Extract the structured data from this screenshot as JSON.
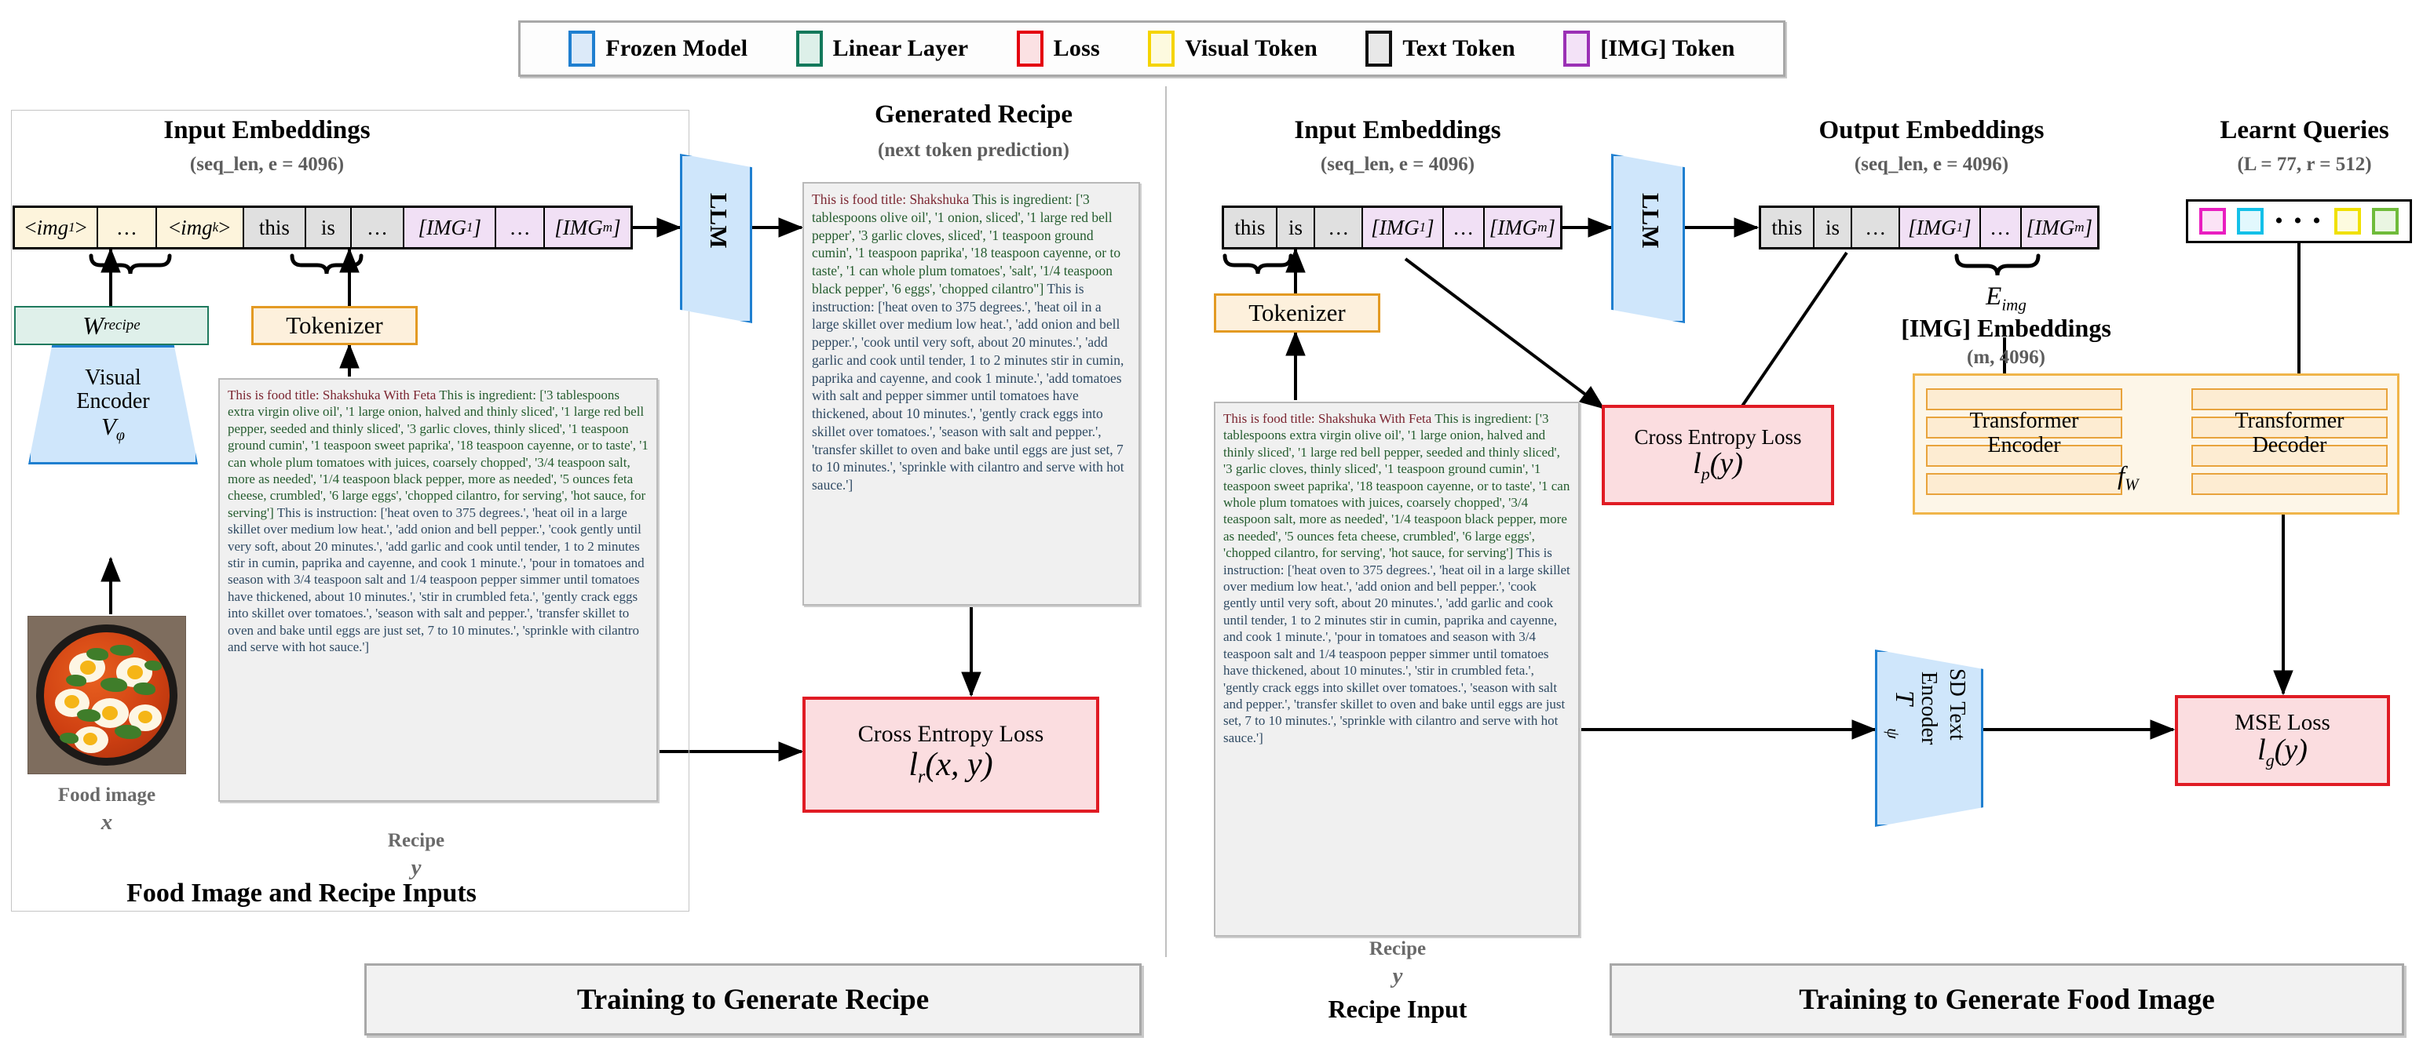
{
  "legend": {
    "items": [
      {
        "label": "Frozen Model",
        "border": "#1f7fd0",
        "fill": "#dceaf9",
        "icon": "frozen-model-swatch"
      },
      {
        "label": "Linear Layer",
        "border": "#13795b",
        "fill": "#ddf0e9",
        "icon": "linear-layer-swatch"
      },
      {
        "label": "Loss",
        "border": "#e4000f",
        "fill": "#fbe1e3",
        "icon": "loss-swatch"
      },
      {
        "label": "Visual Token",
        "border": "#f5d400",
        "fill": "#fdfadf",
        "icon": "visual-token-swatch"
      },
      {
        "label": "Text Token",
        "border": "#111111",
        "fill": "#e8e8e8",
        "icon": "text-token-swatch"
      },
      {
        "label": "[IMG] Token",
        "border": "#9b30b5",
        "fill": "#f3e2f7",
        "icon": "img-token-swatch"
      }
    ]
  },
  "left": {
    "input_embeddings": {
      "title": "Input Embeddings",
      "subtitle": "(seq_len, e = 4096)",
      "tokens": [
        {
          "text": "<img₁>",
          "kind": "visual"
        },
        {
          "text": "…",
          "kind": "visual"
        },
        {
          "text": "<imgₖ>",
          "kind": "visual"
        },
        {
          "text": "this",
          "kind": "text"
        },
        {
          "text": "is",
          "kind": "text"
        },
        {
          "text": "…",
          "kind": "text"
        },
        {
          "text": "[IMG₁]",
          "kind": "img"
        },
        {
          "text": "…",
          "kind": "img"
        },
        {
          "text": "[IMGₘ]",
          "kind": "img"
        }
      ]
    },
    "w_recipe_label": "W",
    "w_recipe_sub": "recipe",
    "tokenizer_label": "Tokenizer",
    "visual_encoder_line1": "Visual",
    "visual_encoder_line2": "Encoder",
    "visual_encoder_sym": "V",
    "visual_encoder_sub": "φ",
    "llm_label": "LLM",
    "food_image_caption": "Food image",
    "food_image_var": "x",
    "recipe_caption": "Recipe",
    "recipe_var": "y",
    "panel_caption": "Food Image and Recipe Inputs",
    "banner": "Training to Generate Recipe",
    "recipe_input_text": {
      "title": "This is food title: Shakshuka With Feta ",
      "ingredients": "This is ingredient: ['3 tablespoons extra virgin olive oil', '1 large onion, halved and thinly sliced', '1 large red bell pepper, seeded and thinly sliced', '3 garlic cloves, thinly sliced', '1 teaspoon ground cumin', '1 teaspoon sweet paprika', '18 teaspoon cayenne, or to taste', '1 can whole plum tomatoes with juices, coarsely chopped', '3/4 teaspoon salt, more as needed', '1/4 teaspoon black pepper, more as needed', '5 ounces feta cheese, crumbled', '6 large eggs', 'chopped cilantro, for serving', 'hot sauce, for serving'] ",
      "instructions": "This is instruction: ['heat oven to 375 degrees.', 'heat oil in a large skillet over medium low heat.', 'add onion and bell pepper.', 'cook gently until very soft, about 20 minutes.', 'add garlic and cook until tender, 1 to 2 minutes stir in cumin, paprika and cayenne, and cook 1 minute.', 'pour in tomatoes and season with 3/4 teaspoon salt and 1/4 teaspoon pepper simmer until tomatoes have thickened, about 10 minutes.', 'stir in crumbled feta.', 'gently crack eggs into skillet over tomatoes.', 'season with salt and pepper.', 'transfer skillet to oven and bake until eggs are just set, 7 to 10 minutes.', 'sprinkle with cilantro and serve with hot sauce.']"
    }
  },
  "middle": {
    "generated_recipe_title": "Generated Recipe",
    "generated_recipe_subtitle": "(next token prediction)",
    "generated_text": {
      "title": "This is food title: Shakshuka ",
      "ingredients": "This is ingredient: ['3 tablespoons olive oil', '1 onion, sliced', '1 large red bell pepper', '3 garlic cloves, sliced', '1 teaspoon ground cumin', '1 teaspoon paprika', '18 teaspoon cayenne, or to taste', '1 can whole plum tomatoes', 'salt', '1/4 teaspoon black pepper', '6 eggs', 'chopped cilantro\"] ",
      "instructions": "This is instruction: ['heat oven to 375 degrees.', 'heat oil in a large skillet over medium low heat.', 'add onion and bell pepper.', 'cook until very soft, about 20 minutes.', 'add garlic and cook until tender, 1 to 2 minutes stir in cumin, paprika and cayenne, and cook 1 minute.', 'add tomatoes with salt and pepper simmer until tomatoes have thickened, about 10 minutes.', 'gently crack eggs into skillet over tomatoes.', 'season with salt and pepper.', 'transfer skillet to oven and bake until eggs are just set, 7 to 10 minutes.', 'sprinkle with cilantro and serve with hot sauce.']"
    },
    "loss_title": "Cross Entropy Loss",
    "loss_math": "l",
    "loss_math_sub": "r",
    "loss_math_args": "(x, y)"
  },
  "right": {
    "input_embeddings": {
      "title": "Input Embeddings",
      "subtitle": "(seq_len, e = 4096)",
      "tokens": [
        {
          "text": "this",
          "kind": "text"
        },
        {
          "text": "is",
          "kind": "text"
        },
        {
          "text": "…",
          "kind": "text"
        },
        {
          "text": "[IMG₁]",
          "kind": "img"
        },
        {
          "text": "…",
          "kind": "img"
        },
        {
          "text": "[IMGₘ]",
          "kind": "img"
        }
      ]
    },
    "output_embeddings": {
      "title": "Output Embeddings",
      "subtitle": "(seq_len, e = 4096)",
      "tokens": [
        {
          "text": "this",
          "kind": "text"
        },
        {
          "text": "is",
          "kind": "text"
        },
        {
          "text": "…",
          "kind": "text"
        },
        {
          "text": "[IMG₁]",
          "kind": "img"
        },
        {
          "text": "…",
          "kind": "img"
        },
        {
          "text": "[IMGₘ]",
          "kind": "img"
        }
      ]
    },
    "e_img_sym": "E",
    "e_img_sub": "img",
    "img_embeddings_title": "[IMG] Embeddings",
    "img_embeddings_shape": "(m, 4096)",
    "learnt_queries_title": "Learnt Queries",
    "learnt_queries_shape": "(L = 77, r = 512)",
    "learnt_queries_colors": [
      "#e91ec0",
      "#13c0e8",
      "#f0e000",
      "#6fbb3a"
    ],
    "learnt_queries_dots": "• • •",
    "tokenizer_label": "Tokenizer",
    "llm_label": "LLM",
    "transformer_encoder_line1": "Transformer",
    "transformer_encoder_line2": "Encoder",
    "transformer_decoder_line1": "Transformer",
    "transformer_decoder_line2": "Decoder",
    "f_w_sym": "f",
    "f_w_sub": "W",
    "sd_text_encoder_line1": "SD Text",
    "sd_text_encoder_line2": "Encoder",
    "sd_text_encoder_sym": "T",
    "sd_text_encoder_sub": "ψ",
    "ce_loss_title": "Cross Entropy Loss",
    "ce_loss_math": "l",
    "ce_loss_math_sub": "p",
    "ce_loss_math_args": "(y)",
    "mse_loss_title": "MSE Loss",
    "mse_loss_math": "l",
    "mse_loss_math_sub": "g",
    "mse_loss_math_args": "(y)",
    "recipe_caption": "Recipe",
    "recipe_var": "y",
    "recipe_input_caption": "Recipe Input",
    "banner": "Training to Generate Food Image",
    "recipe_input_text": {
      "title": "This is food title: Shakshuka With Feta ",
      "ingredients": "This is ingredient: ['3 tablespoons extra virgin olive oil', '1 large onion, halved and thinly sliced', '1 large red bell pepper, seeded and thinly sliced', '3 garlic cloves, thinly sliced', '1 teaspoon ground cumin', '1 teaspoon sweet paprika', '18 teaspoon cayenne, or to taste', '1 can whole plum tomatoes with juices, coarsely chopped', '3/4 teaspoon salt, more as needed', '1/4 teaspoon black pepper, more as needed', '5 ounces feta cheese, crumbled', '6 large eggs', 'chopped cilantro, for serving', 'hot sauce, for serving'] ",
      "instructions": "This is instruction: ['heat oven to 375 degrees.', 'heat oil in a large skillet over medium low heat.', 'add onion and bell pepper.', 'cook gently until very soft, about 20 minutes.', 'add garlic and cook until tender, 1 to 2 minutes stir in cumin, paprika and cayenne, and cook 1 minute.', 'pour in tomatoes and season with 3/4 teaspoon salt and 1/4 teaspoon pepper simmer until tomatoes have thickened, about 10 minutes.', 'stir in crumbled feta.', 'gently crack eggs into skillet over tomatoes.', 'season with salt and pepper.', 'transfer skillet to oven and bake until eggs are just set, 7 to 10 minutes.', 'sprinkle with cilantro and serve with hot sauce.']"
    }
  }
}
